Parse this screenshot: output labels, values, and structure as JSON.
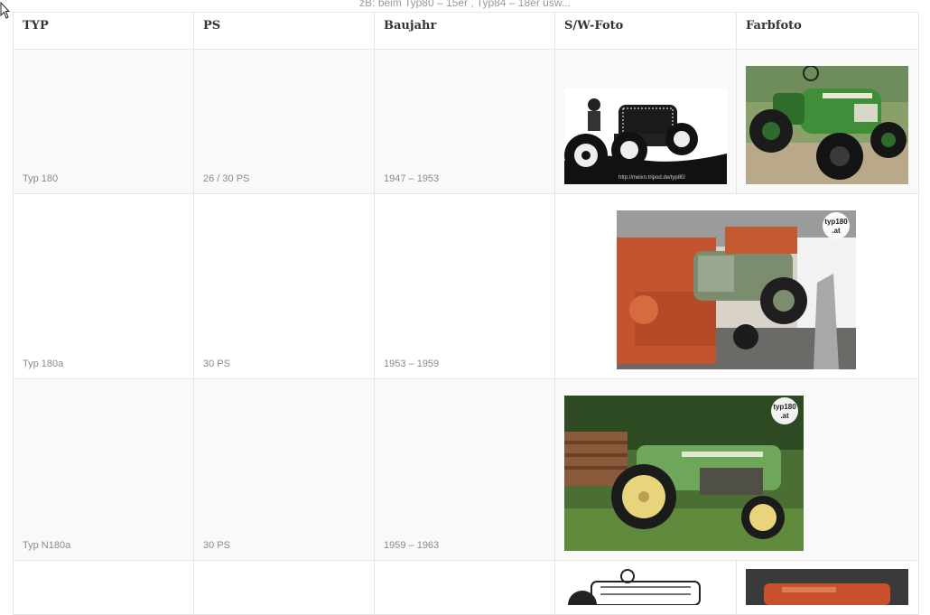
{
  "hint": "zB: beim Typ80 – 15er , Typ84 – 18er usw...",
  "table": {
    "headers": [
      "TYP",
      "PS",
      "Baujahr",
      "S/W-Foto",
      "Farbfoto"
    ],
    "rows": [
      {
        "typ": "Typ 180",
        "ps": "26 / 30 PS",
        "baujahr": "1947 – 1953"
      },
      {
        "typ": "Typ 180a",
        "ps": "30 PS",
        "baujahr": "1953 – 1959"
      },
      {
        "typ": "Typ N180a",
        "ps": "30 PS",
        "baujahr": "1959 – 1963"
      },
      {
        "typ": "",
        "ps": "",
        "baujahr": ""
      }
    ]
  },
  "watermarks": {
    "sw_photo_1": "http://meixn.tripod.de/typ80/",
    "badge_name": "typ180",
    "badge_tld": ".at"
  },
  "colors": {
    "tractor_green": "#3f8f3a",
    "tractor_red": "#c8502c",
    "grid_line": "#e6e6e6"
  }
}
